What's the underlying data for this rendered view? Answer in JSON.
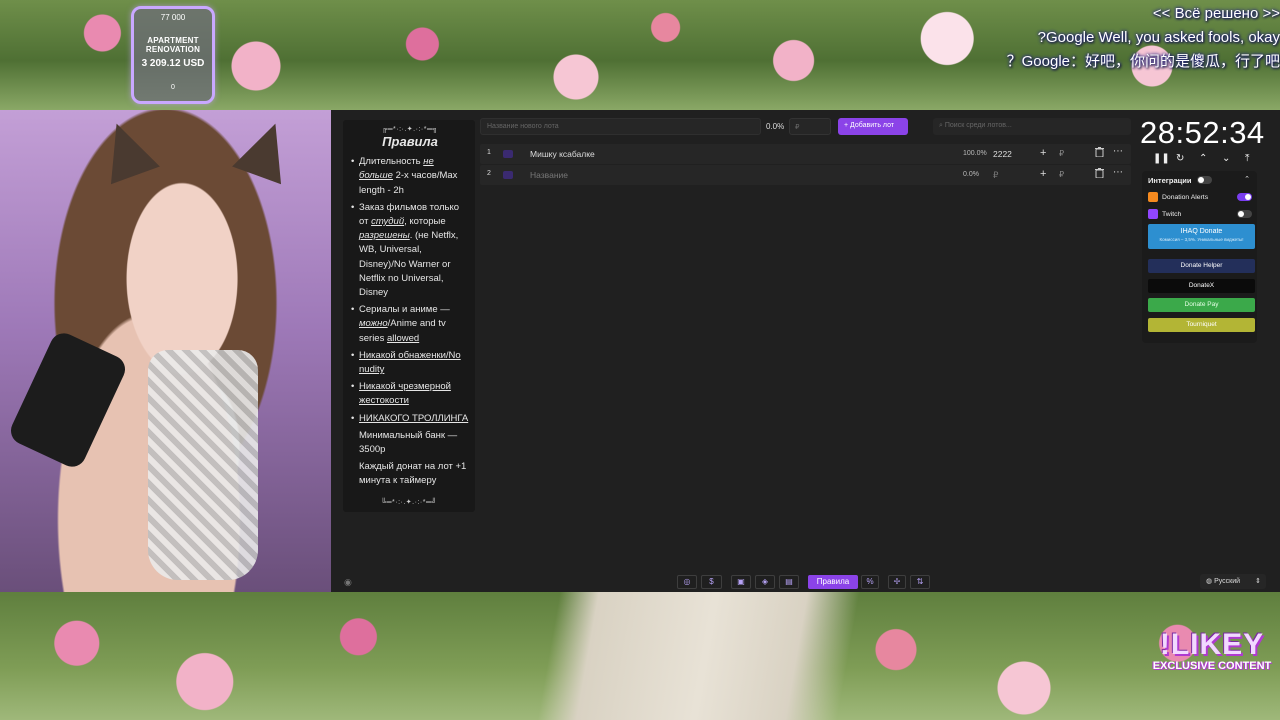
{
  "goal": {
    "target": "77 000",
    "name_line1": "APARTMENT",
    "name_line2": "RENOVATION",
    "amount": "3 209.12 USD",
    "start": "0"
  },
  "subtitles": [
    "<< Всё решено >>",
    "?Google Well, you asked fools, okay",
    "？Google：好吧，你问的是傻瓜，行了吧"
  ],
  "rules": {
    "ornament_top": "╔═*·:·.✦.·:·*═╗",
    "title": "Правила",
    "ornament_bottom": "╚═*·:·.✦.·:·*═╝",
    "items": {
      "duration_a": "Длительность ",
      "duration_b": "не больше",
      "duration_c": " 2-х часов/Max length - 2h",
      "films_a": "Заказ фильмов только от ",
      "films_b": "студий",
      "films_c": ", которые ",
      "films_d": "разрешены",
      "films_e": ". (не Netflx, WB, Universal, Disney)/No Warner or Netflix no Universal, Disney",
      "series_a": "Сериалы и аниме — ",
      "series_b": "можно",
      "series_c": "/Anime and tv series ",
      "series_d": "allowed",
      "no_nudity": "Никакой обнаженки/No nudity",
      "no_violence": "Никакой чрезмерной жестокости",
      "no_trolling": "НИКАКОГО ТРОЛЛИНГА",
      "min_bank": "Минимальный банк — 3500р",
      "donate_time": "Каждый донат на лот +1 минута к таймеру"
    }
  },
  "toprow": {
    "lot_placeholder": "Название нового лота",
    "percent": "0.0%",
    "amount_placeholder": "₽",
    "add_label": "+ Добавить лот",
    "search_placeholder": "Поиск среди лотов..."
  },
  "lots": [
    {
      "n": "1",
      "name": "Мишку ксабалке",
      "pct": "100.0%",
      "amount": "2222",
      "currency": "₽"
    },
    {
      "n": "2",
      "name": "Название",
      "pct": "0.0%",
      "amount": "₽",
      "currency": "₽"
    }
  ],
  "timer": {
    "value": "28:52:34",
    "pause": "❚❚",
    "reset": "↻",
    "up": "⌃",
    "down": "⌄",
    "top": "⤒"
  },
  "integrations": {
    "title": "Интеграции",
    "caret": "⌃",
    "services": [
      {
        "label": "Donation Alerts",
        "color": "#f58a1f",
        "on": true
      },
      {
        "label": "Twitch",
        "color": "#9146ff",
        "on": false
      }
    ],
    "ihaq_title": "IHAQ Donate",
    "ihaq_sub": "Комиссия – 3,5%. Уникальные виджеты!",
    "donate_helper": "Donate Helper",
    "donatex": "DonateX",
    "donate_pay": "Donate Pay",
    "tourniquet": "Tourniquet"
  },
  "toolbar": {
    "github": "◎",
    "dollar": "$",
    "b1": "▣",
    "b2": "◈",
    "b3": "▤",
    "rules": "Правила",
    "percent": "%",
    "b4": "✢",
    "b5": "⇅",
    "eye": "◉"
  },
  "language": "Русский",
  "badge": {
    "big": "!LIKEY",
    "small": "EXCLUSIVE CONTENT"
  }
}
